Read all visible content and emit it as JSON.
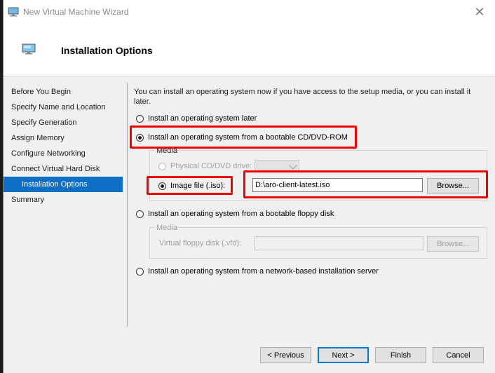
{
  "window": {
    "title": "New Virtual Machine Wizard",
    "close_glyph": "✕"
  },
  "header": {
    "title": "Installation Options"
  },
  "nav": {
    "items": [
      {
        "label": "Before You Begin"
      },
      {
        "label": "Specify Name and Location"
      },
      {
        "label": "Specify Generation"
      },
      {
        "label": "Assign Memory"
      },
      {
        "label": "Configure Networking"
      },
      {
        "label": "Connect Virtual Hard Disk"
      },
      {
        "label": "Installation Options",
        "selected": true
      },
      {
        "label": "Summary"
      }
    ]
  },
  "content": {
    "intro": "You can install an operating system now if you have access to the setup media, or you can install it later.",
    "options": {
      "later": "Install an operating system later",
      "cd": "Install an operating system from a bootable CD/DVD-ROM",
      "floppy": "Install an operating system from a bootable floppy disk",
      "network": "Install an operating system from a network-based installation server"
    },
    "selected_option": "cd",
    "media": {
      "label": "Media",
      "physical_drive": "Physical CD/DVD drive:",
      "physical_drive_value": "",
      "image_file": "Image file (.iso):",
      "image_file_value": "D:\\aro-client-latest.iso",
      "selected_media": "image_file",
      "browse": "Browse..."
    },
    "floppy_media": {
      "label": "Media",
      "virtual_floppy": "Virtual floppy disk (.vfd):",
      "virtual_floppy_value": "",
      "browse": "Browse..."
    }
  },
  "buttons": {
    "previous": "< Previous",
    "next": "Next >",
    "finish": "Finish",
    "cancel": "Cancel"
  },
  "colors": {
    "highlight": "#ee0000",
    "selection": "#0f6fc6",
    "accent": "#0078d7"
  }
}
